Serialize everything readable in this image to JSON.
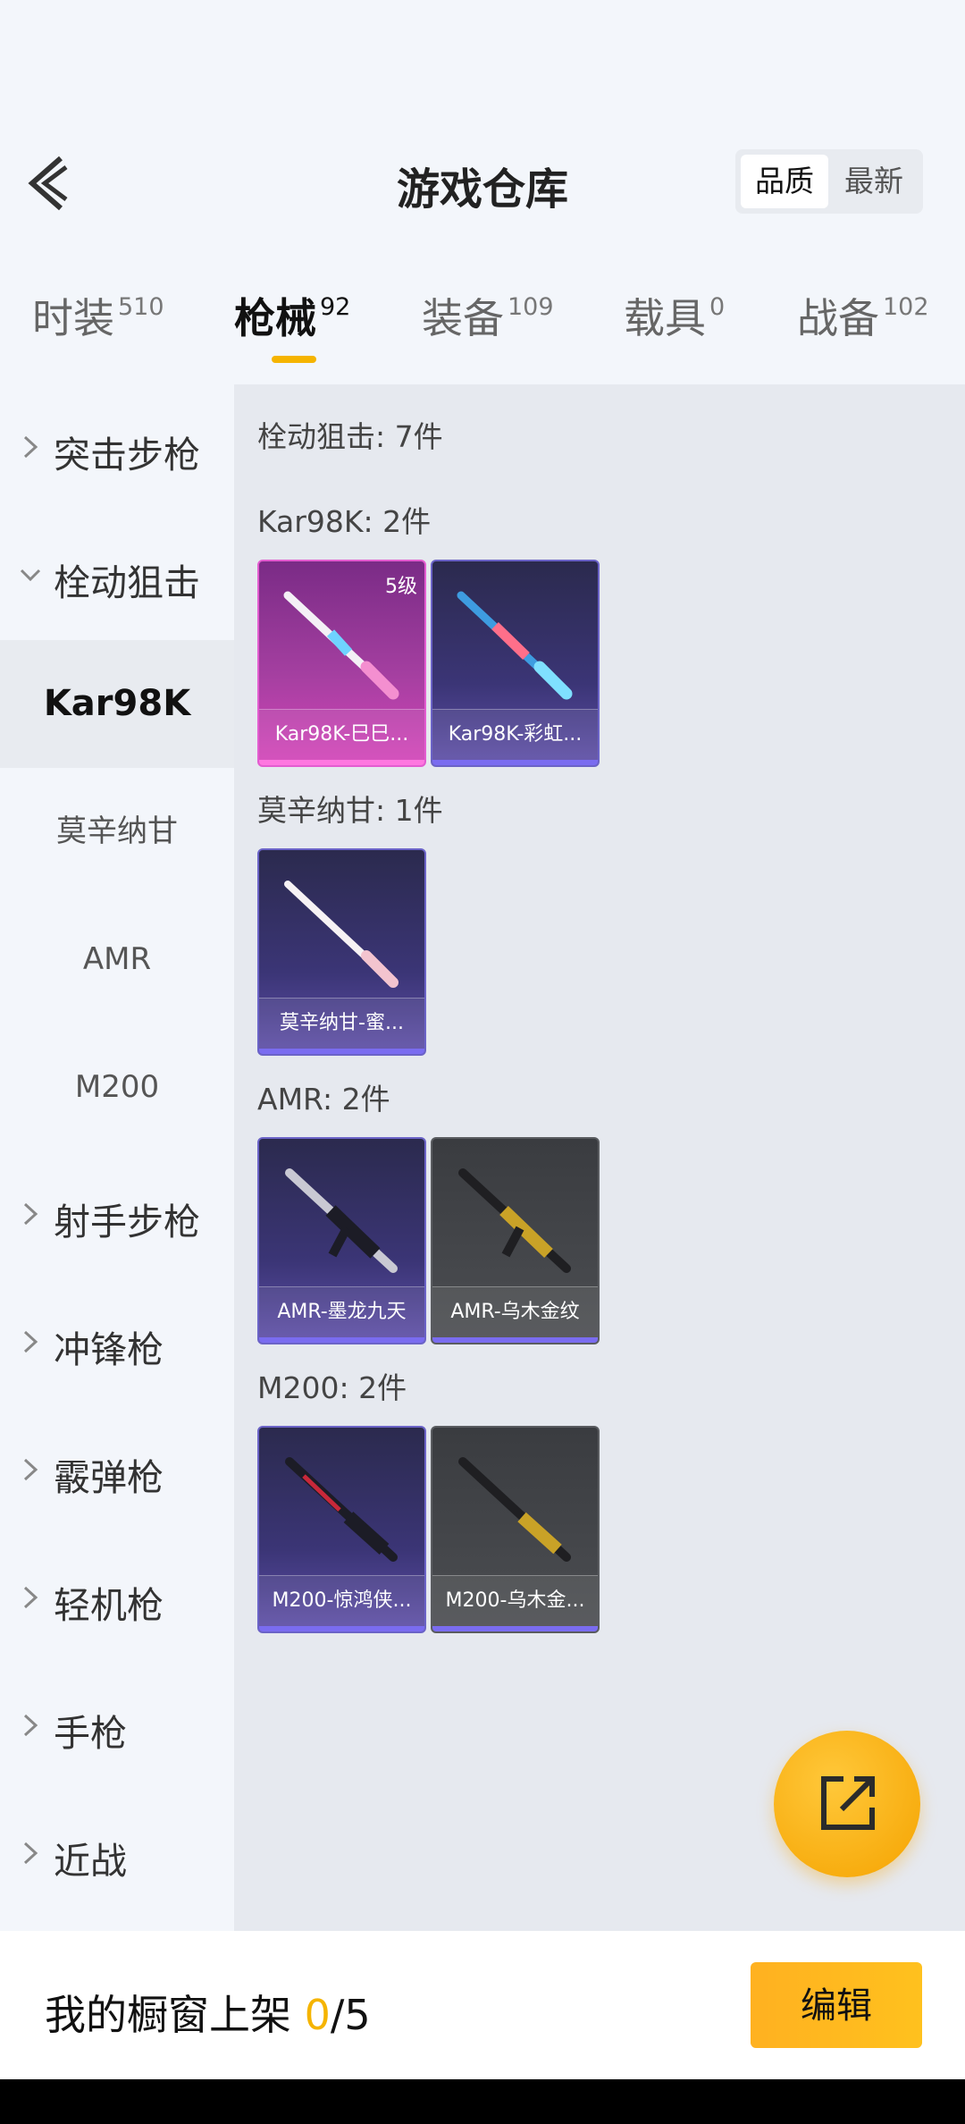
{
  "header": {
    "title": "游戏仓库",
    "sort": {
      "active": "品质",
      "other": "最新"
    }
  },
  "tabs": [
    {
      "label": "时装",
      "count": "510"
    },
    {
      "label": "枪械",
      "count": "92"
    },
    {
      "label": "装备",
      "count": "109"
    },
    {
      "label": "载具",
      "count": "0"
    },
    {
      "label": "战备",
      "count": "102"
    }
  ],
  "sidebar": {
    "groups": [
      "突击步枪",
      "栓动狙击",
      "射手步枪",
      "冲锋枪",
      "霰弹枪",
      "轻机枪",
      "手枪",
      "近战"
    ],
    "subs": [
      "Kar98K",
      "莫辛纳甘",
      "AMR",
      "M200"
    ]
  },
  "main": {
    "header": "栓动狙击: 7件",
    "sections": [
      {
        "title": "Kar98K: 2件",
        "items": [
          {
            "name": "Kar98K-巳巳...",
            "level": "5级"
          },
          {
            "name": "Kar98K-彩虹..."
          }
        ]
      },
      {
        "title": "莫辛纳甘: 1件",
        "items": [
          {
            "name": "莫辛纳甘-蜜..."
          }
        ]
      },
      {
        "title": "AMR: 2件",
        "items": [
          {
            "name": "AMR-墨龙九天"
          },
          {
            "name": "AMR-乌木金纹"
          }
        ]
      },
      {
        "title": "M200: 2件",
        "items": [
          {
            "name": "M200-惊鸿侠..."
          },
          {
            "name": "M200-乌木金..."
          }
        ]
      }
    ]
  },
  "bottom": {
    "label": "我的橱窗上架",
    "current": "0",
    "total": "/5",
    "edit_label": "编辑"
  },
  "colors": {
    "accent": "#f5b400",
    "purple": "#6b63c7",
    "pink": "#e35cd0",
    "gray": "#5a5c60"
  }
}
